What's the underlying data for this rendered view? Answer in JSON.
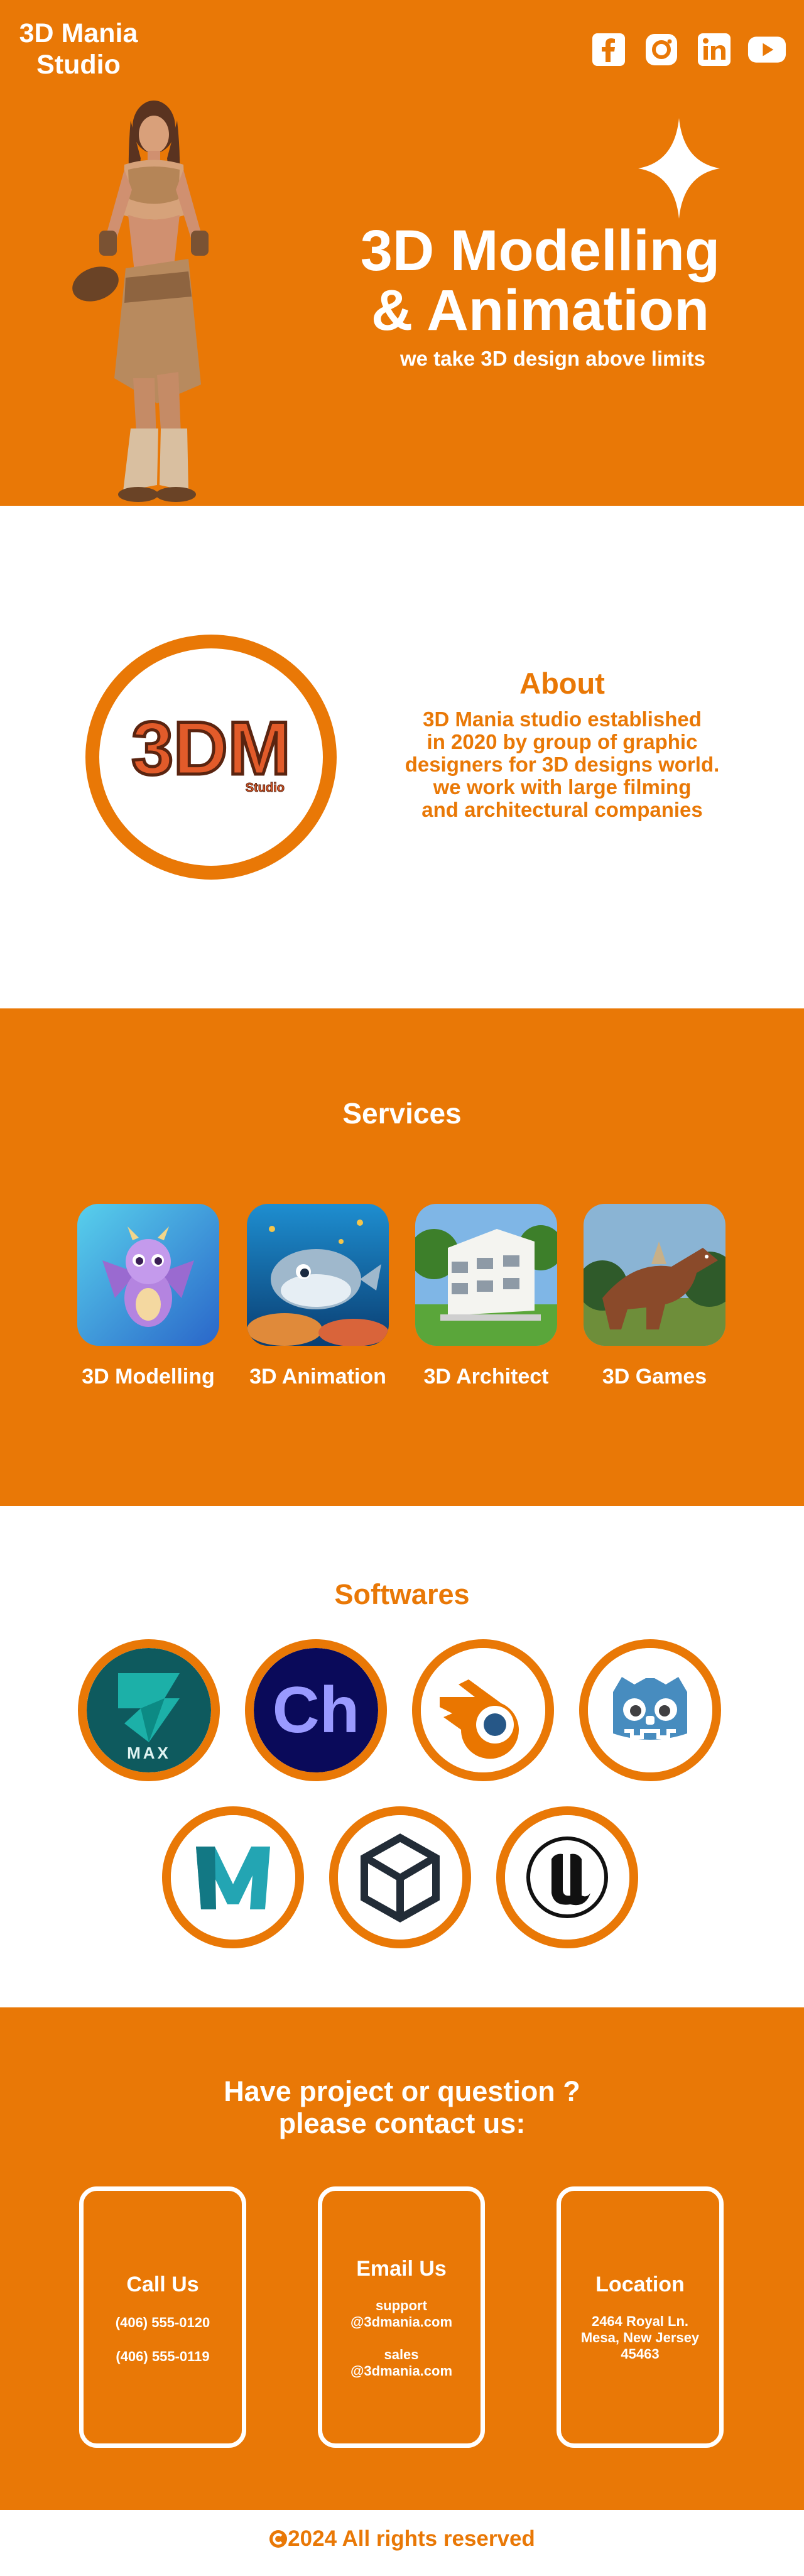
{
  "brand": {
    "line1": "3D Mania",
    "line2": "Studio"
  },
  "social": [
    {
      "icon": "facebook-icon"
    },
    {
      "icon": "instagram-icon"
    },
    {
      "icon": "linkedin-icon"
    },
    {
      "icon": "youtube-icon"
    }
  ],
  "hero": {
    "title_line1": "3D Modelling",
    "title_line2": "& Animation",
    "subtitle": "we take 3D design above limits"
  },
  "about": {
    "logo_text": "3DM",
    "logo_sub": "Studio",
    "title": "About",
    "lines": [
      "3D Mania studio established",
      "in 2020 by group of graphic",
      "designers for 3D designs world.",
      "we work with large filming",
      "and architectural companies"
    ]
  },
  "services": {
    "title": "Services",
    "items": [
      {
        "label": "3D Modelling"
      },
      {
        "label": "3D Animation"
      },
      {
        "label": "3D Architect"
      },
      {
        "label": "3D Games"
      }
    ]
  },
  "softwares": {
    "title": "Softwares",
    "items": [
      {
        "icon": "3ds-max-icon",
        "text": "MAX"
      },
      {
        "icon": "character-animator-icon",
        "text": "Ch"
      },
      {
        "icon": "blender-icon"
      },
      {
        "icon": "godot-icon"
      },
      {
        "icon": "maya-icon"
      },
      {
        "icon": "unity-icon"
      },
      {
        "icon": "unreal-engine-icon"
      }
    ]
  },
  "contact": {
    "title_line1": "Have project or question ?",
    "title_line2": "please contact us:",
    "call": {
      "title": "Call Us",
      "phone1": "(406) 555-0120",
      "phone2": "(406) 555-0119"
    },
    "email": {
      "title": "Email Us",
      "support1": "support",
      "support2": "@3dmania.com",
      "sales1": "sales",
      "sales2": "@3dmania.com"
    },
    "location": {
      "title": "Location",
      "line1": "2464 Royal Ln.",
      "line2": "Mesa, New Jersey",
      "line3": "45463"
    }
  },
  "footer": {
    "text": "2024 All rights reserved",
    "icon": "copyright-icon"
  },
  "colors": {
    "accent": "#e97806",
    "white": "#ffffff"
  }
}
